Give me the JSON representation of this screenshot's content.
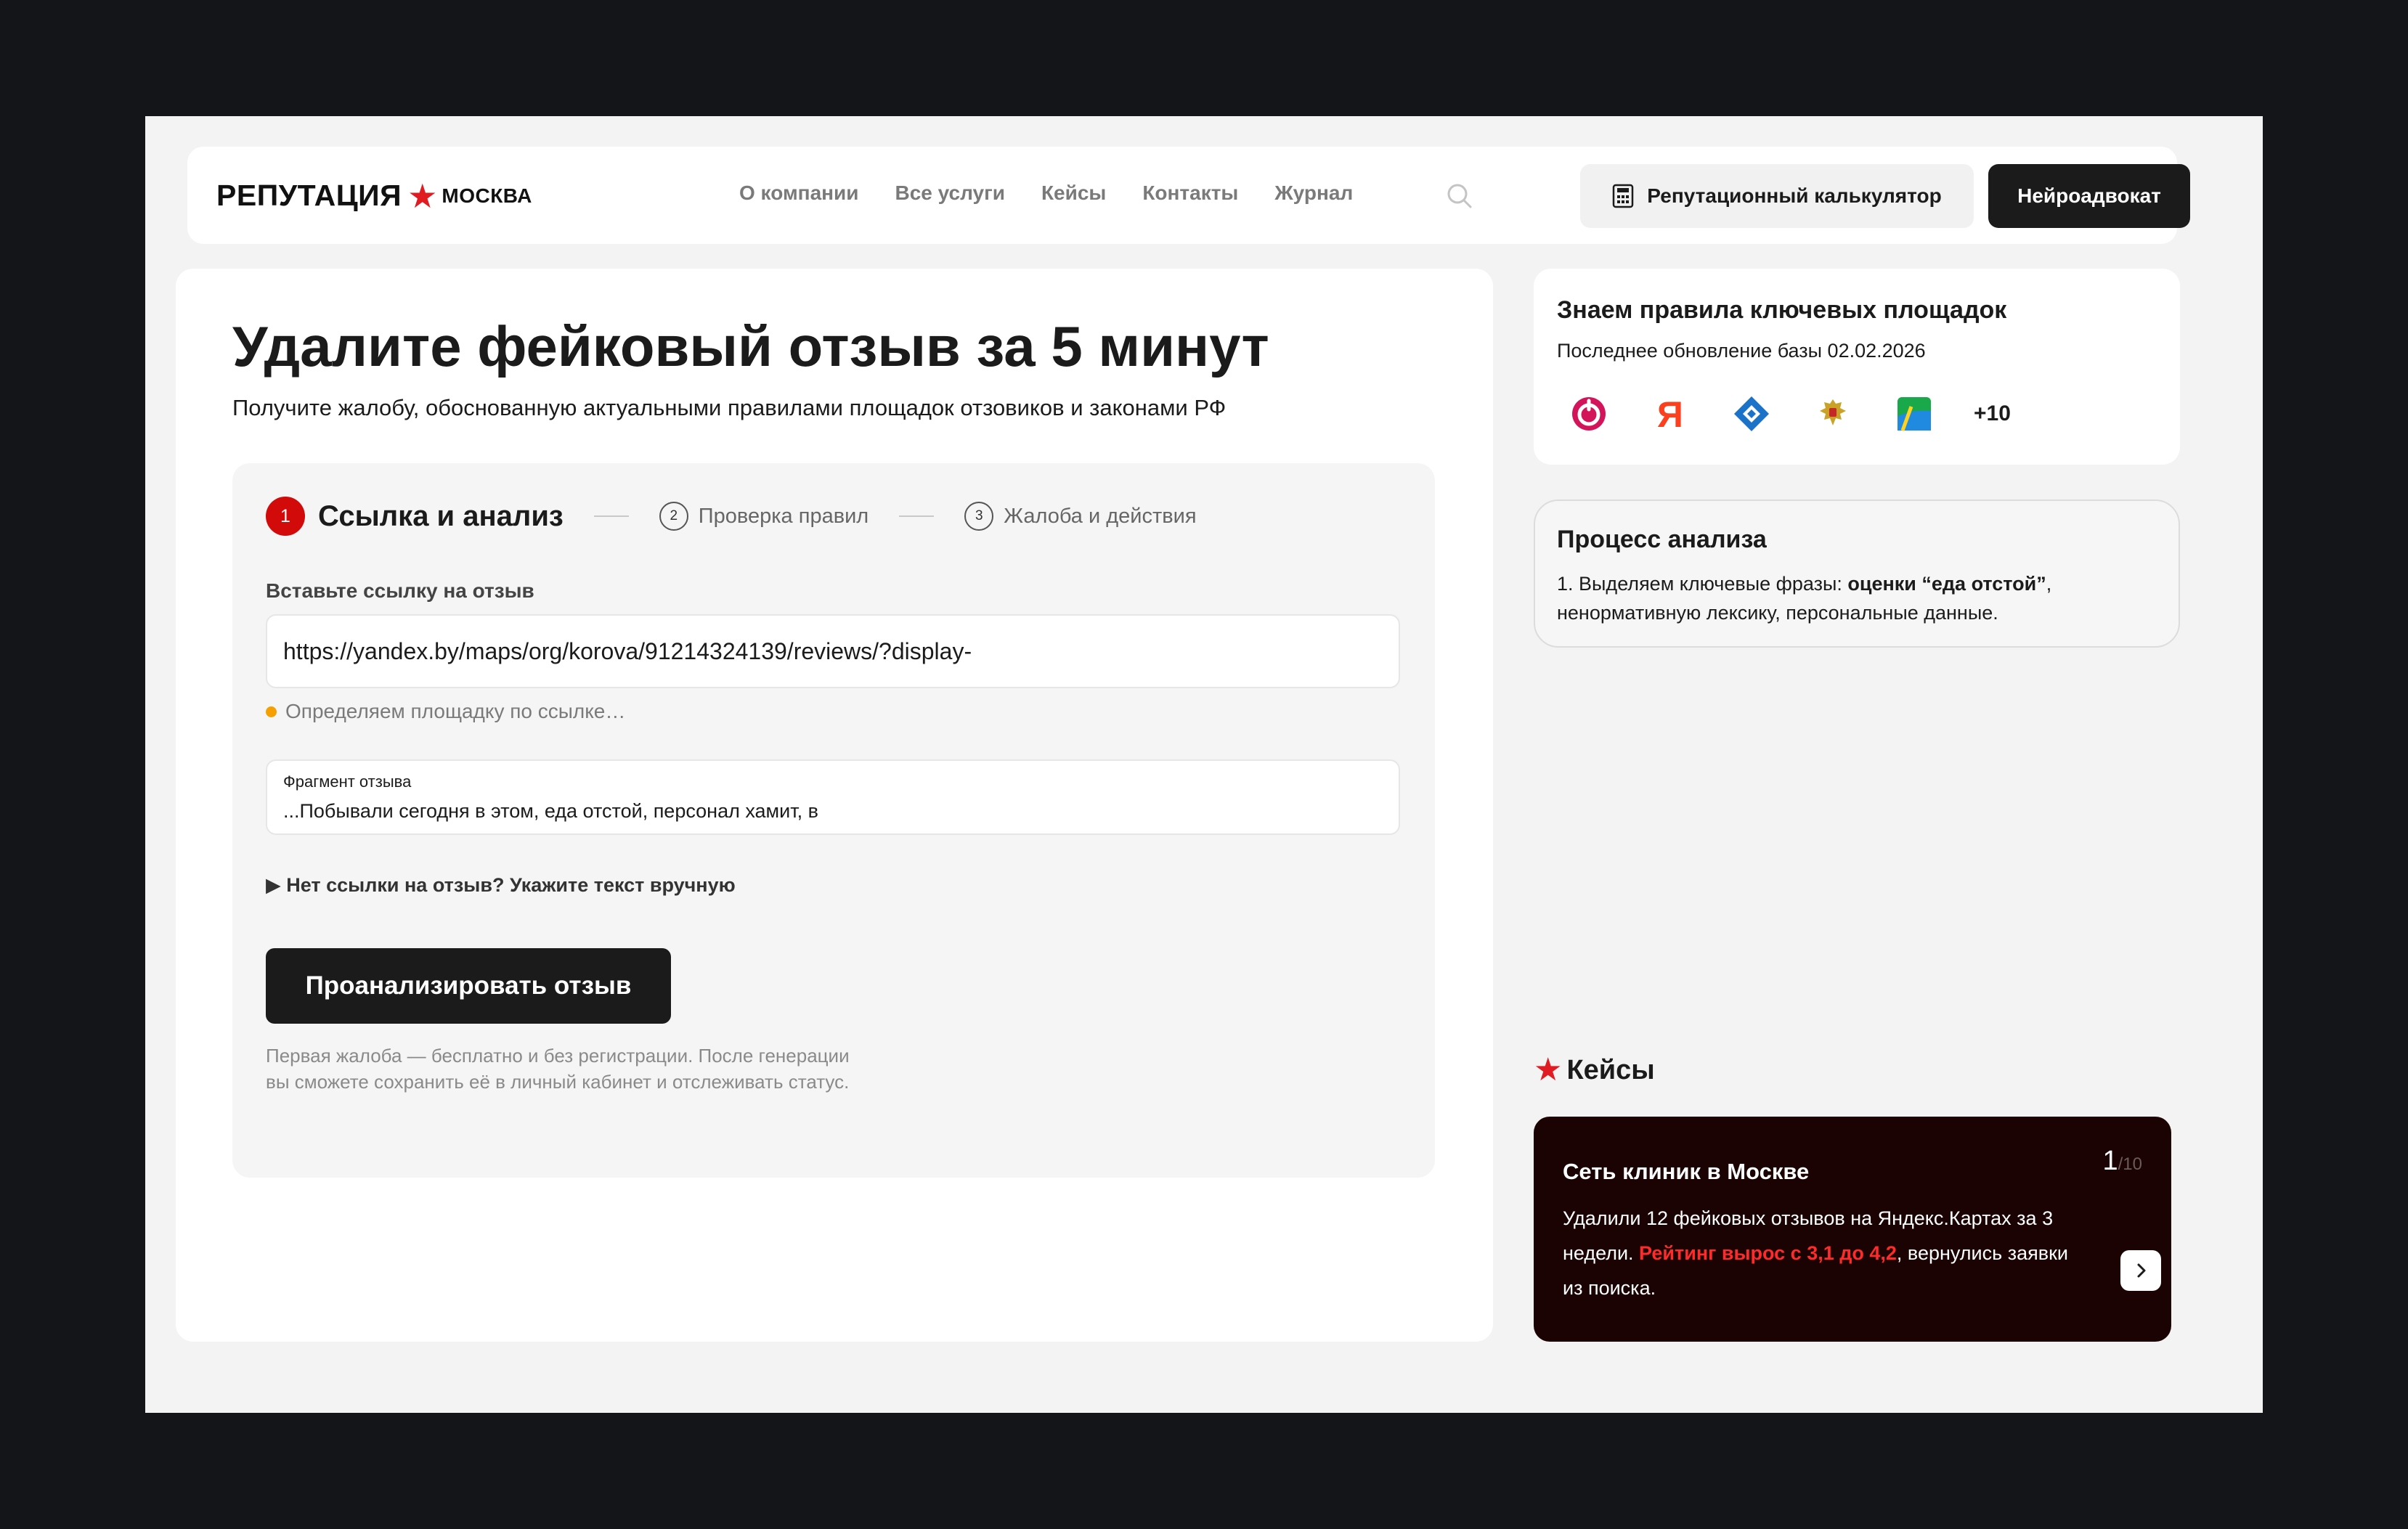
{
  "header": {
    "logo_main": "РЕПУТАЦИЯ",
    "logo_city": "МОСКВА",
    "nav": [
      "О компании",
      "Все услуги",
      "Кейсы",
      "Контакты",
      "Журнал"
    ],
    "calc_button": "Репутационный калькулятор",
    "neuro_button": "Нейроадвокат"
  },
  "hero": {
    "title": "Удалите фейковый отзыв за 5 минут",
    "subtitle": "Получите жалобу, обоснованную актуальными правилами площадок отзовиков и законами РФ"
  },
  "steps": [
    {
      "num": "1",
      "label": "Ссылка и анализ"
    },
    {
      "num": "2",
      "label": "Проверка правил"
    },
    {
      "num": "3",
      "label": "Жалоба и действия"
    }
  ],
  "form": {
    "url_label": "Вставьте ссылку на отзыв",
    "url_value": "https://yandex.by/maps/org/korova/91214324139/reviews/?display-",
    "status": "Определяем площадку по ссылке…",
    "fragment_label": "Фрагмент отзыва",
    "fragment_text": "...Побывали сегодня в этом, еда отстой, персонал хамит, в",
    "manual_toggle": "▶ Нет ссылки на отзыв? Укажите текст вручную",
    "analyze_button": "Проанализировать отзыв",
    "footnote_line1": "Первая жалоба — бесплатно и без регистрации. После генерации",
    "footnote_line2": "вы сможете сохранить её в личный кабинет и отслеживать статус."
  },
  "rules": {
    "title": "Знаем правила ключевых площадок",
    "update": "Последнее обновление базы 02.02.2026",
    "platform_icons": [
      "otzovik-icon",
      "yandex-icon",
      "roskomnadzor-icon",
      "emblem-icon",
      "2gis-icon"
    ],
    "more": "+10"
  },
  "process": {
    "title": "Процесс анализа",
    "text_prefix": "1. Выделяем ключевые фразы: ",
    "text_bold": "оценки “еда отстой”",
    "text_suffix": ", ненормативную лексику, персональные данные."
  },
  "cases": {
    "heading": "Кейсы",
    "card_title": "Сеть клиник в Москве",
    "counter_current": "1",
    "counter_total": "/10",
    "text_prefix": "Удалили 12 фейковых отзывов на Яндекс.Картах за 3 недели. ",
    "text_highlight": "Рейтинг вырос с 3,1 до 4,2",
    "text_suffix": ", вернулись заявки из поиска."
  },
  "colors": {
    "accent_red": "#e11b22",
    "dark": "#1b1b1b",
    "case_bg": "#1c0303",
    "status_dot": "#f5a000"
  }
}
